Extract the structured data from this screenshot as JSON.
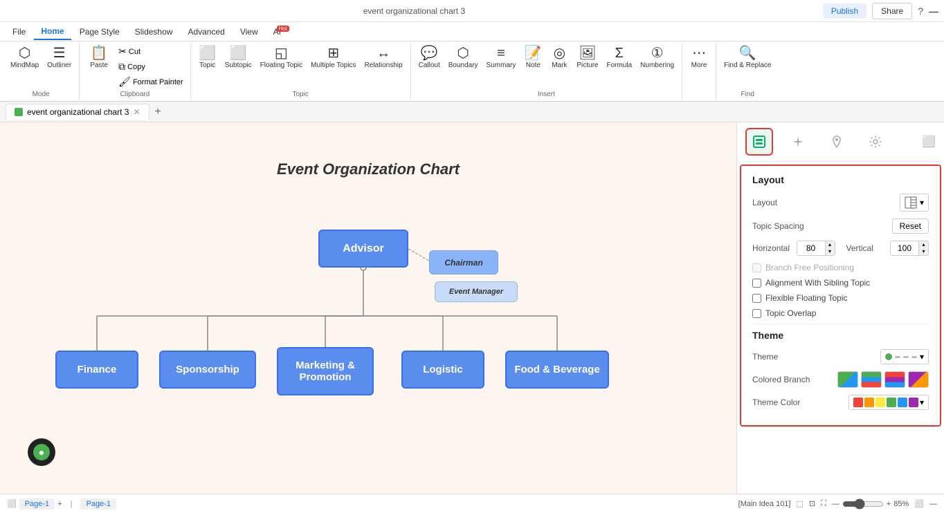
{
  "tabs": {
    "ribbon": [
      "File",
      "Home",
      "Page Style",
      "Slideshow",
      "Advanced",
      "View",
      "AI"
    ],
    "active_tab": "Home",
    "ai_hot": true
  },
  "title_bar": {
    "publish": "Publish",
    "share": "Share",
    "help_icon": "?"
  },
  "doc_tab": {
    "name": "event organizational chart 3",
    "favicon_color": "#4caf50"
  },
  "ribbon_groups": {
    "mode": {
      "label": "Mode",
      "mindmap": "MindMap",
      "outliner": "Outliner"
    },
    "clipboard": {
      "label": "Clipboard",
      "paste": "Paste",
      "cut": "Cut",
      "copy": "Copy",
      "format_painter": "Format Painter"
    },
    "topic": {
      "label": "Topic",
      "topic": "Topic",
      "subtopic": "Subtopic",
      "floating_topic": "Floating Topic",
      "multiple_topics": "Multiple Topics",
      "relationship": "Relationship"
    },
    "insert": {
      "label": "Insert",
      "callout": "Callout",
      "boundary": "Boundary",
      "summary": "Summary",
      "note": "Note",
      "mark": "Mark",
      "picture": "Picture",
      "formula": "Formula",
      "numbering": "Numbering"
    },
    "more": {
      "label": "",
      "more": "More"
    },
    "find": {
      "label": "Find",
      "find_replace": "Find & Replace",
      "find": "Find"
    }
  },
  "canvas": {
    "title": "Event Organization Chart",
    "nodes": {
      "advisor": "Advisor",
      "chairman": "Chairman",
      "event_manager": "Event Manager",
      "finance": "Finance",
      "sponsorship": "Sponsorship",
      "marketing": "Marketing & Promotion",
      "logistic": "Logistic",
      "food": "Food & Beverage"
    }
  },
  "right_panel": {
    "icons": [
      "layout-icon",
      "sparkle-icon",
      "location-icon",
      "settings-icon"
    ],
    "layout_section": {
      "title": "Layout",
      "layout_label": "Layout",
      "topic_spacing_label": "Topic Spacing",
      "reset_label": "Reset",
      "horizontal_label": "Horizontal",
      "horizontal_value": "80",
      "vertical_label": "Vertical",
      "vertical_value": "100",
      "branch_free_label": "Branch Free Positioning",
      "alignment_label": "Alignment With Sibling Topic",
      "flexible_label": "Flexible Floating Topic",
      "overlap_label": "Topic Overlap"
    },
    "theme_section": {
      "title": "Theme",
      "theme_label": "Theme",
      "colored_branch_label": "Colored Branch",
      "theme_color_label": "Theme Color"
    }
  },
  "bottom_bar": {
    "page_minus": "−",
    "page_name_left": "Page-1",
    "page_add": "+",
    "page_name_right": "Page-1",
    "status": "[Main Idea 101]",
    "zoom_label": "85%",
    "zoom_minus": "—",
    "zoom_plus": "+"
  }
}
